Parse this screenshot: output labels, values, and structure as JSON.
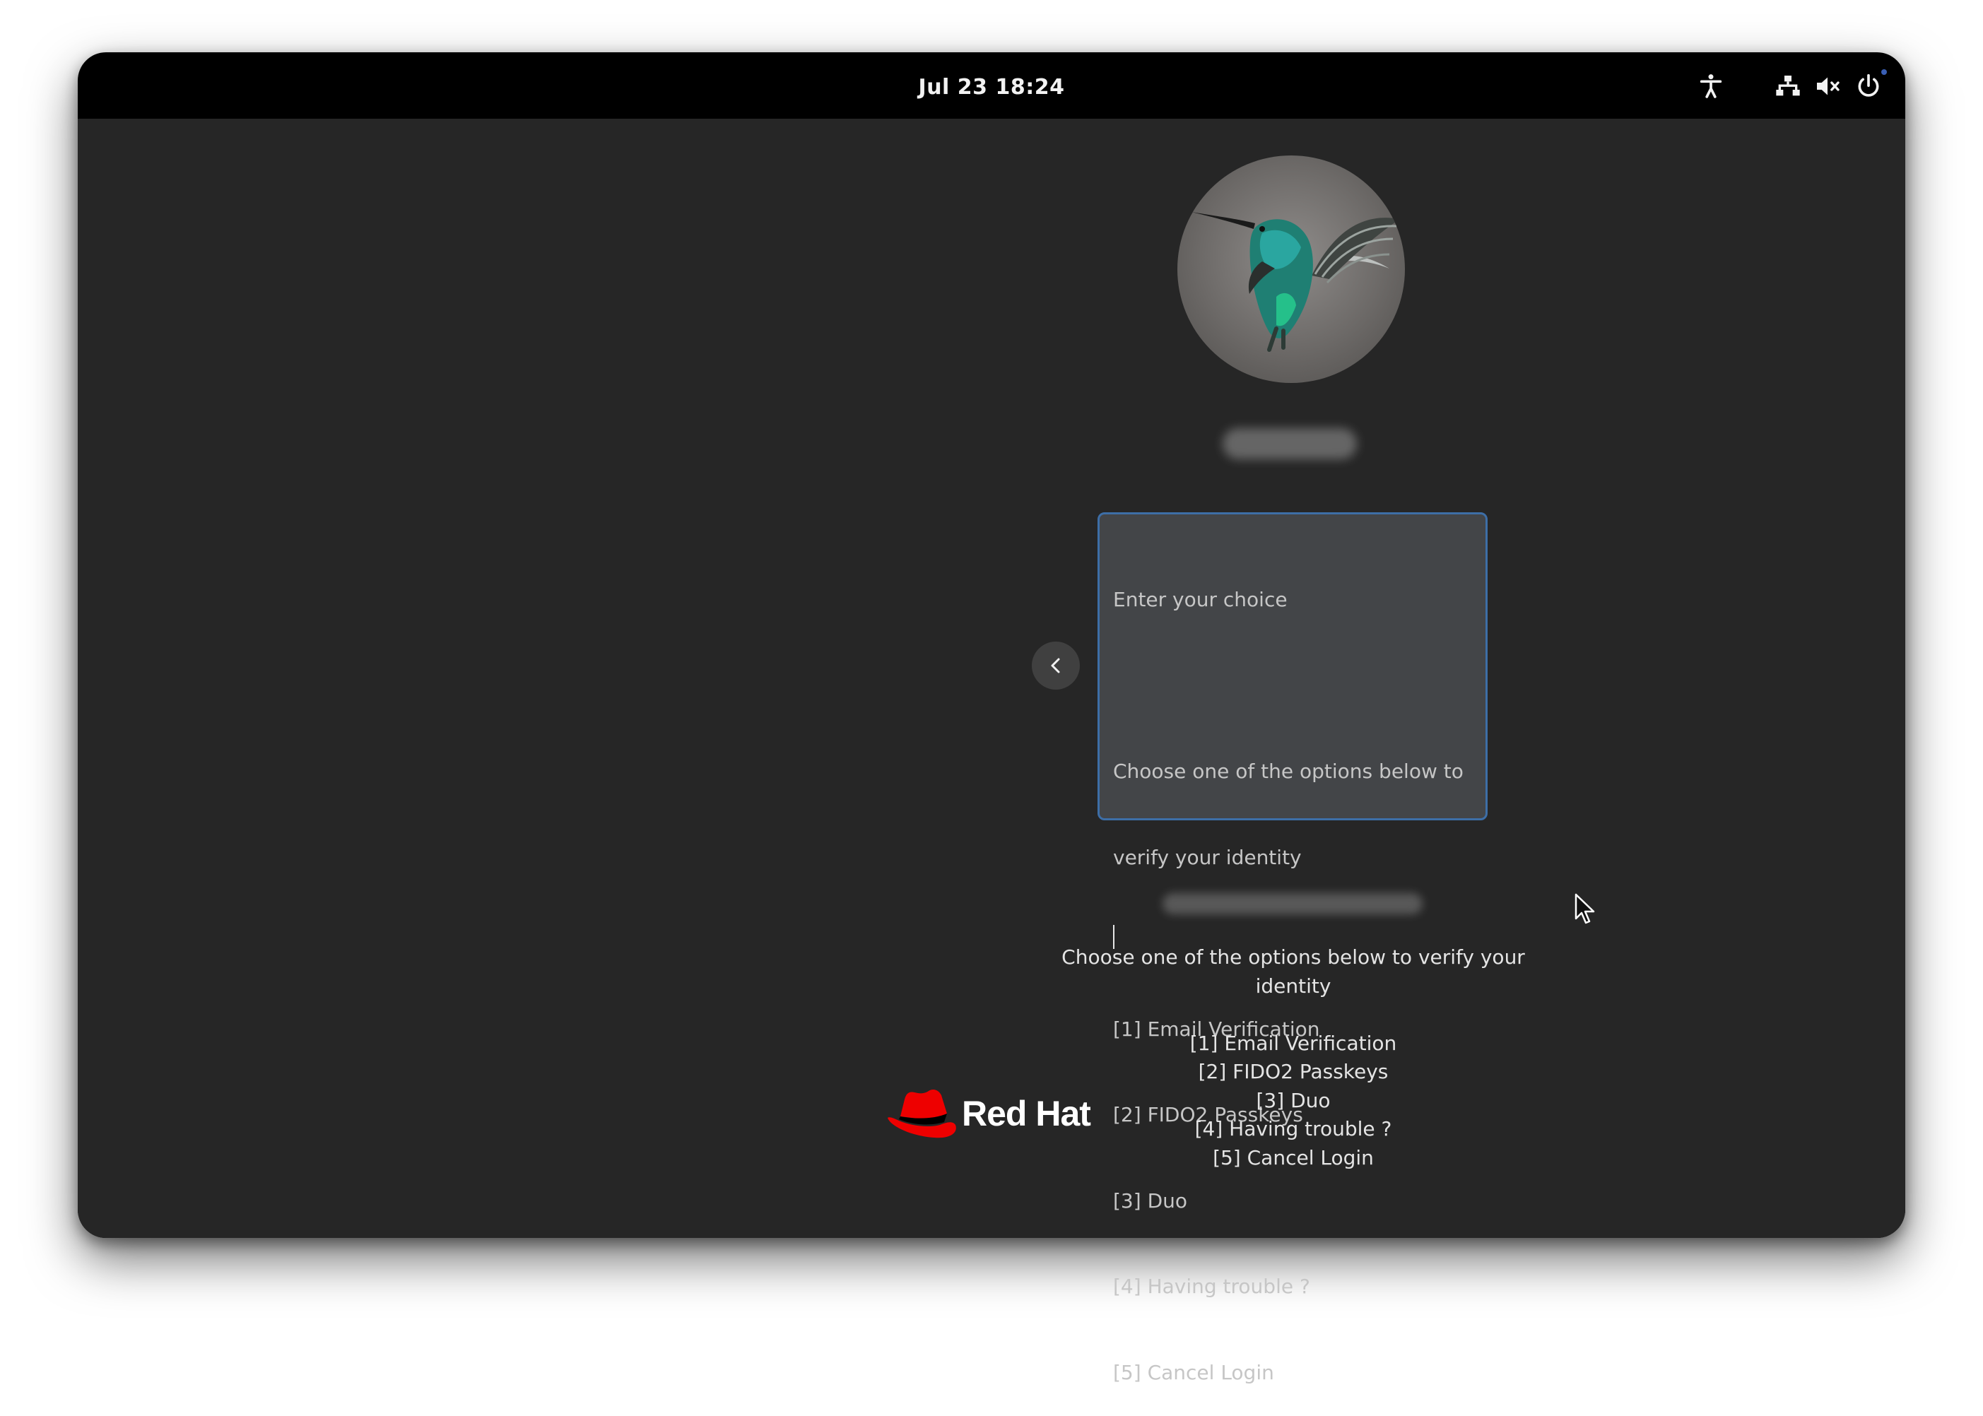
{
  "top_bar": {
    "clock": "Jul 23  18:24"
  },
  "tray": {
    "icons": [
      "accessibility-icon",
      "network-icon",
      "volume-muted-icon",
      "power-icon"
    ]
  },
  "login": {
    "avatar_subject": "hummingbird",
    "prompt": {
      "lines": [
        "Enter your choice",
        "",
        "Choose one of the options below to",
        "verify your identity",
        "",
        "[1] Email Verification",
        "[2] FIDO2 Passkeys",
        "[3] Duo",
        "[4] Having trouble ?",
        "[5] Cancel Login"
      ]
    },
    "message": {
      "lines": [
        "Choose one of the options below to verify your",
        "identity",
        "",
        "[1] Email Verification",
        "[2] FIDO2 Passkeys",
        "[3] Duo",
        "[4] Having trouble ?",
        "[5] Cancel Login"
      ]
    }
  },
  "branding": {
    "logo_text": "Red Hat"
  },
  "colors": {
    "background": "#262626",
    "prompt_border": "#3d6ea7",
    "prompt_fill": "#434548",
    "brand_red": "#ee0000"
  }
}
